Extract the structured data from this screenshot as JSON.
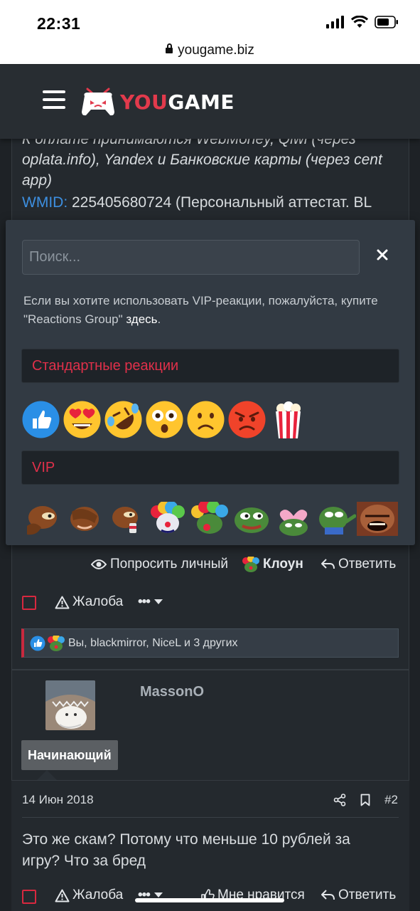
{
  "status_bar": {
    "time": "22:31",
    "url": "yougame.biz"
  },
  "header": {
    "logo_you": "YOU",
    "logo_game": "GAME"
  },
  "background_text": {
    "line1": "К оплате принимаются WebMoney, Qiwi (через",
    "line2": "oplata.info), Yandex и Банковские карты (через cent",
    "line3": "app)",
    "wmid_label": "WMID:",
    "wmid_value": " 225405680724 (Персональный аттестат. BL"
  },
  "popup": {
    "search_placeholder": "Поиск...",
    "notice_text": "Если вы хотите использовать VIP-реакции, пожалуйста, купите \"Reactions Group\" ",
    "notice_link": "здесь",
    "notice_end": ".",
    "standard_header": "Стандартные реакции",
    "vip_header": "VIP",
    "standard_reactions": [
      "like-icon",
      "heart-eyes-icon",
      "rofl-icon",
      "astonished-icon",
      "sad-icon",
      "angry-icon",
      "popcorn-icon"
    ],
    "vip_reactions": [
      "pepe-brown-think-icon",
      "pepe-brown-facepalm-icon",
      "pepe-brown-drink-icon",
      "clown-1-icon",
      "clown-2-icon",
      "pepe-frog-icon",
      "pepe-heart-icon",
      "pepe-point-icon",
      "laugh-man-icon"
    ]
  },
  "post1": {
    "request_label": "Попросить личный",
    "reaction_label": "Клоун",
    "reply_label": "Ответить",
    "report_label": "Жалоба",
    "more_label": "•••",
    "reaction_summary": "Вы, blackmirror, NiceL и 3 других"
  },
  "post2": {
    "username": "MassonO",
    "rank": "Начинающий",
    "date": "14 Июн 2018",
    "number": "#2",
    "text": "Это же скам? Потому что меньше 10 рублей за игру? Что за бред",
    "report_label": "Жалоба",
    "more_label": "•••",
    "dislike_label": "Мне нравится",
    "reply_label": "Ответить"
  },
  "colors": {
    "accent_red": "#e0304a",
    "link_blue": "#3d8fe0",
    "bg": "#1e2226",
    "popup_bg": "#323a43"
  }
}
